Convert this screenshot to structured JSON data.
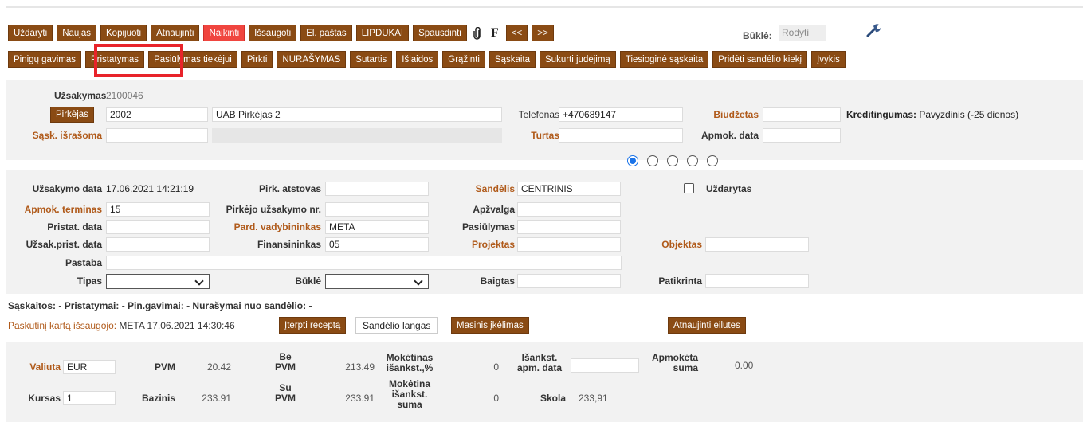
{
  "toolbar1": {
    "buttons": [
      "Uždaryti",
      "Naujas",
      "Kopijuoti",
      "Atnaujinti",
      "Naikinti",
      "Išsaugoti",
      "El. paštas",
      "LIPDUKAI",
      "Spausdinti"
    ],
    "attach_icon": "paperclip-icon",
    "f_label": "F",
    "prev_label": "<<",
    "next_label": ">>",
    "status_label": "Būklė:",
    "status_value": "Rodyti",
    "tool_icon": "wrench-icon",
    "danger_color": "#f0453f"
  },
  "toolbar2": {
    "buttons": [
      "Pinigų gavimas",
      "Pristatymas",
      "Pasiūlymas tiekėjui",
      "Pirkti",
      "NURAŠYMAS",
      "Sutartis",
      "Išlaidos",
      "Grąžinti",
      "Sąskaita",
      "Sukurti judėjimą",
      "Tiesioginė sąskaita",
      "Pridėti sandėlio kiekį",
      "Įvykis"
    ],
    "highlight_color": "#e8232a",
    "accent_color": "#8a4b14"
  },
  "header": {
    "order_label": "Užsakymas",
    "order_value": "2100046",
    "buyer_button": "Pirkėjas",
    "buyer_code": "2002",
    "buyer_name": "UAB Pirkėjas 2",
    "phone_label": "Telefonas",
    "phone_value": "+470689147",
    "budget_label": "Biudžetas",
    "budget_value": "",
    "credit_label": "Kreditingumas:",
    "credit_value": "Pavyzdinis (-25 dienos)",
    "invoice_label": "Sąsk. išrašoma",
    "invoice_value": "",
    "asset_label": "Turtas",
    "asset_value": "",
    "paydate_label": "Apmok. data",
    "paydate_value": ""
  },
  "details": {
    "order_date_label": "Užsakymo data",
    "order_date_value": "17.06.2021 14:21:19",
    "buyer_rep_label": "Pirk. atstovas",
    "buyer_rep_value": "",
    "warehouse_label": "Sandėlis",
    "warehouse_value": "CENTRINIS",
    "closed_label": "Uždarytas",
    "pay_term_label": "Apmok. terminas",
    "pay_term_value": "15",
    "buyer_order_label": "Pirkėjo užsakymo nr.",
    "buyer_order_value": "",
    "review_label": "Apžvalga",
    "review_value": "",
    "delivery_date_label": "Pristat. data",
    "delivery_date_value": "",
    "sales_manager_label": "Pard. vadybininkas",
    "sales_manager_value": "META",
    "offer_label": "Pasiūlymas",
    "offer_value": "",
    "order_delivery_label": "Užsak.prist. data",
    "order_delivery_value": "",
    "financier_label": "Finansininkas",
    "financier_value": "05",
    "project_label": "Projektas",
    "project_value": "",
    "object_label": "Objektas",
    "object_value": "",
    "note_label": "Pastaba",
    "note_value": "",
    "type_label": "Tipas",
    "type_value": "",
    "state_label": "Būklė",
    "state_value": "",
    "finished_label": "Baigtas",
    "finished_value": "",
    "checked_label": "Patikrinta",
    "checked_value": ""
  },
  "summary_line": "Sąskaitos: - Pristatymai: - Pin.gavimai: - Nurašymai nuo sandėlio: -",
  "last_saved": {
    "label": "Paskutinį kartą išsaugojo:",
    "value": "META 17.06.2021 14:30:46"
  },
  "actions": {
    "insert_recipe": "Įterpti receptą",
    "warehouse_window": "Sandėlio langas",
    "mass_insert": "Masinis įkėlimas",
    "refresh_rows": "Atnaujinti eilutes"
  },
  "totals": {
    "currency_label": "Valiuta",
    "currency_value": "EUR",
    "vat_label": "PVM",
    "vat_value": "20.42",
    "without_vat_label": "Be PVM",
    "without_vat_value": "213.49",
    "prepay_pct_label": "Mokėtinas išankst.,%",
    "prepay_pct_value": "0",
    "prepay_date_label": "Išankst. apm. data",
    "prepay_date_value": "",
    "paid_label": "Apmokėta suma",
    "paid_value": "0.00",
    "rate_label": "Kursas",
    "rate_value": "1",
    "base_label": "Bazinis",
    "base_value": "233.91",
    "with_vat_label": "Su PVM",
    "with_vat_value": "233.91",
    "prepay_sum_label": "Mokėtina išankst. suma",
    "prepay_sum_value": "0",
    "debt_label": "Skola",
    "debt_value": "233,91"
  }
}
